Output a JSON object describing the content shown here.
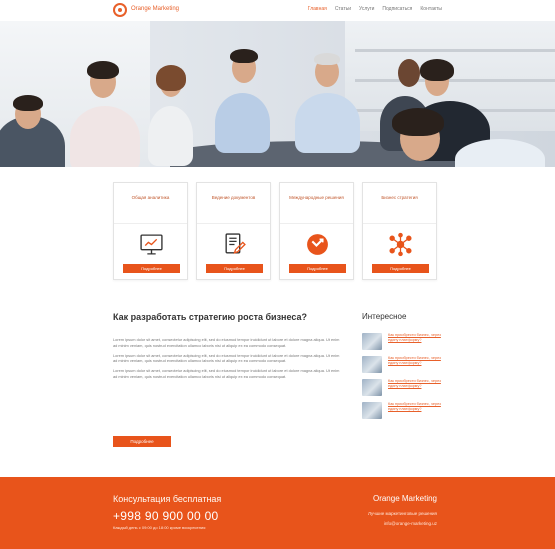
{
  "header": {
    "brand": "Orange Marketing",
    "nav": [
      "Главная",
      "Статьи",
      "Услуги",
      "Подписаться",
      "Контакты"
    ]
  },
  "cards": [
    {
      "title": "Общая аналитика",
      "icon": "monitor-chart-icon",
      "button": "Подробнее"
    },
    {
      "title": "Ведение документов",
      "icon": "document-edit-icon",
      "button": "Подробнее"
    },
    {
      "title": "Международные решения",
      "icon": "globe-arrow-icon",
      "button": "Подробнее"
    },
    {
      "title": "Бизнес стратегия",
      "icon": "network-nodes-icon",
      "button": "Подробнее"
    }
  ],
  "article": {
    "title": "Как разработать стратегию роста бизнеса?",
    "paragraphs": [
      "Lorem ipsum dolor sit amet, consectetur adipiscing elit, sed do eiusmod tempor incididunt ut labore et dolore magna aliqua. Ut enim ad minim veniam, quis nostrud exercitation ullamco laboris nisi ut aliquip ex ea commodo consequat.",
      "Lorem ipsum dolor sit amet, consectetur adipiscing elit, sed do eiusmod tempor incididunt ut labore et dolore magna aliqua. Ut enim ad minim veniam, quis nostrud exercitation ullamco laboris nisi ut aliquip ex ea commodo consequat.",
      "Lorem ipsum dolor sit amet, consectetur adipiscing elit, sed do eiusmod tempor incididunt ut labore et dolore magna aliqua. Ut enim ad minim veniam, quis nostrud exercitation ullamco laboris nisi ut aliquip ex ea commodo consequat."
    ],
    "button": "Подробнее"
  },
  "sidebar": {
    "title": "Интересное",
    "items": [
      "Как приобрести бизнес, через едину платформу?",
      "Как приобрести бизнес, через едину платформу?",
      "Как приобрести бизнес, через едину платформу?",
      "Как приобрести бизнес, через едину платформу?"
    ]
  },
  "footer": {
    "consult": "Консультация бесплатная",
    "phone": "+998 90 900 00 00",
    "hours": "Каждый день с 09:00 до 18:00 кроме воскресения",
    "brand": "Orange Marketing",
    "tagline": "Лучшие маркетинговые решения",
    "email": "info@orange-marketing.uz"
  },
  "colors": {
    "accent": "#e8541b",
    "accent_text": "#e8602a"
  }
}
